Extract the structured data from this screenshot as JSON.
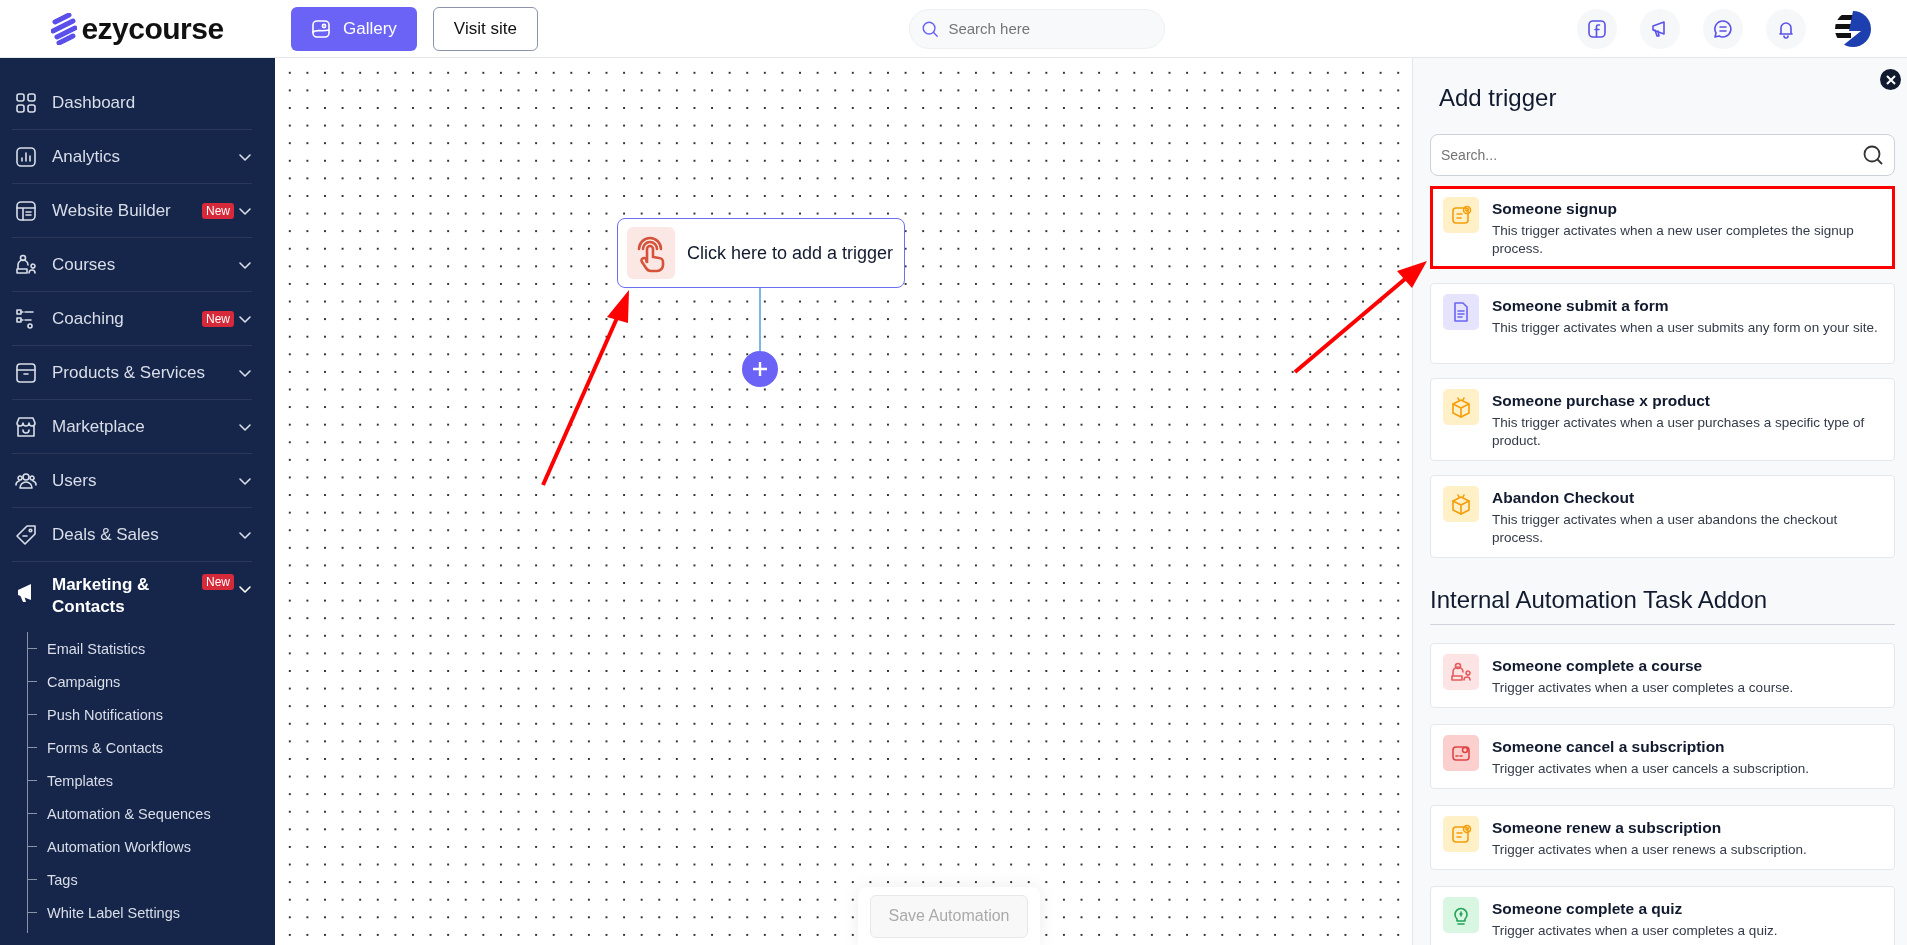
{
  "logo": {
    "text": "ezycourse"
  },
  "topbar": {
    "buttons": [
      {
        "label": "Gallery",
        "kind": "primary"
      },
      {
        "label": "Visit site",
        "kind": "outline"
      }
    ],
    "search": {
      "placeholder": "Search here"
    }
  },
  "sidebar": {
    "items": [
      {
        "label": "Dashboard",
        "kind": "link",
        "selected": false
      },
      {
        "label": "Analytics",
        "kind": "group",
        "selected": false
      },
      {
        "label": "Website Builder",
        "kind": "group",
        "badge": "New",
        "selected": false
      },
      {
        "label": "Courses",
        "kind": "group",
        "selected": false
      },
      {
        "label": "Coaching",
        "kind": "group",
        "badge": "New",
        "selected": false
      },
      {
        "label": "Products & Services",
        "kind": "group",
        "selected": false
      },
      {
        "label": "Marketplace",
        "kind": "group",
        "selected": false
      },
      {
        "label": "Users",
        "kind": "group",
        "selected": false
      },
      {
        "label": "Deals & Sales",
        "kind": "group",
        "selected": false
      },
      {
        "label": "Marketing & Contacts",
        "kind": "group",
        "badge": "New",
        "selected": true,
        "children": [
          "Email Statistics",
          "Campaigns",
          "Push Notifications",
          "Forms & Contacts",
          "Templates",
          "Automation & Sequences",
          "Automation Workflows",
          "Tags",
          "White Label Settings"
        ]
      }
    ]
  },
  "canvas": {
    "node": {
      "label": "Click here to add a trigger"
    },
    "save_button": {
      "label": "Save Automation",
      "disabled": true
    }
  },
  "panel": {
    "title": "Add trigger",
    "search": {
      "placeholder": "Search..."
    },
    "triggers": [
      {
        "title": "Someone signup",
        "description": "This trigger activates when a new user completes the signup process.",
        "color": "#fff0c7",
        "highlighted": true
      },
      {
        "title": "Someone submit a form",
        "description": "This trigger activates when a user submits any form on your site.",
        "color": "#e6e4fd",
        "highlighted": false
      },
      {
        "title": "Someone purchase x product",
        "description": "This trigger activates when a user purchases a specific type of product.",
        "color": "#fff0c7",
        "highlighted": false
      },
      {
        "title": "Abandon Checkout",
        "description": "This trigger activates when a user abandons the checkout process.",
        "color": "#fff0c7",
        "highlighted": false
      }
    ],
    "sections": [
      {
        "heading": "Internal Automation Task Addon",
        "triggers": [
          {
            "title": "Someone complete a course",
            "description": "Trigger activates when a user completes a course.",
            "color": "#fde4e4",
            "highlighted": false
          },
          {
            "title": "Someone cancel a subscription",
            "description": "Trigger activates when a user cancels a subscription.",
            "color": "#fccfcf",
            "highlighted": false
          },
          {
            "title": "Someone renew a subscription",
            "description": "Trigger activates when a user renews a subscription.",
            "color": "#fff0c7",
            "highlighted": false
          },
          {
            "title": "Someone complete a quiz",
            "description": "Trigger activates when a user completes a quiz.",
            "color": "#d8f6e1",
            "highlighted": false
          }
        ]
      }
    ]
  }
}
